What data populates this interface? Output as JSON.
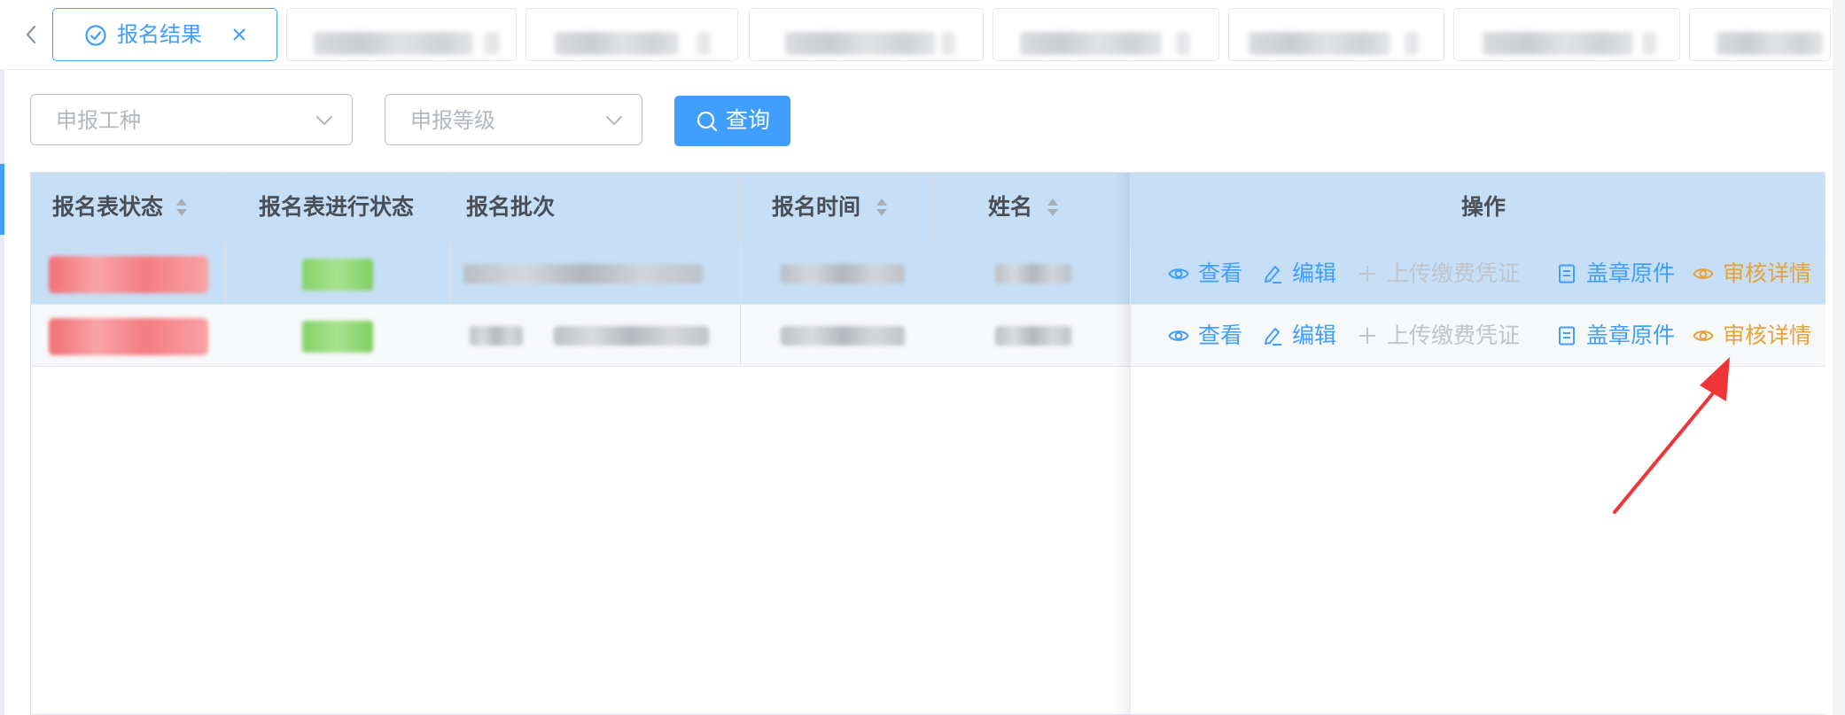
{
  "tabs": {
    "active_label": "报名结果"
  },
  "filters": {
    "job_type_placeholder": "申报工种",
    "level_placeholder": "申报等级",
    "query_label": "查询"
  },
  "table": {
    "columns": {
      "form_status": "报名表状态",
      "progress_status": "报名表进行状态",
      "batch": "报名批次",
      "time": "报名时间",
      "name": "姓名",
      "actions": "操作"
    },
    "actions": {
      "view": "查看",
      "edit": "编辑",
      "upload_receipt": "上传缴费凭证",
      "stamped_original": "盖章原件",
      "review_detail": "审核详情"
    }
  },
  "colors": {
    "primary": "#409eff",
    "disabled": "#c0c4cc",
    "warning": "#e6a23c",
    "header_bg": "#c6dff6",
    "annotation": "#f0353a"
  }
}
